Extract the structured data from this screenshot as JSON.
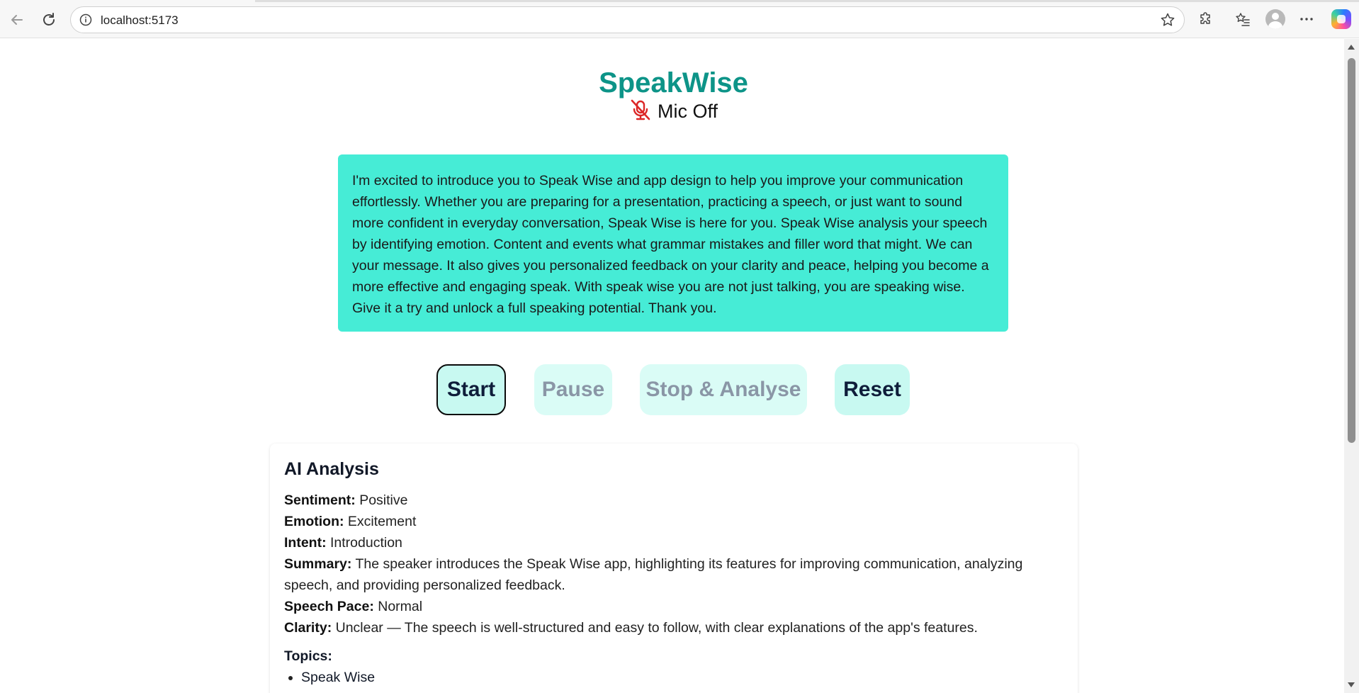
{
  "browser": {
    "url": "localhost:5173"
  },
  "app": {
    "title": "SpeakWise",
    "mic_status": "Mic Off",
    "accent_color": "#0d9488",
    "transcript_bg": "#46ecd6",
    "mic_icon_color": "#dc2626"
  },
  "transcript": {
    "text": "I'm excited to introduce you to Speak Wise and app design to help you improve your communication effortlessly. Whether you are preparing for a presentation, practicing a speech, or just want to sound more confident in everyday conversation, Speak Wise is here for you. Speak Wise analysis your speech by identifying emotion. Content and events what grammar mistakes and filler word that might. We can your message. It also gives you personalized feedback on your clarity and peace, helping you become a more effective and engaging speak. With speak wise you are not just talking, you are speaking wise. Give it a try and unlock a full speaking potential. Thank you."
  },
  "controls": {
    "start": "Start",
    "pause": "Pause",
    "stop": "Stop & Analyse",
    "reset": "Reset"
  },
  "analysis": {
    "heading": "AI Analysis",
    "fields": [
      {
        "label": "Sentiment:",
        "value": "Positive"
      },
      {
        "label": "Emotion:",
        "value": "Excitement"
      },
      {
        "label": "Intent:",
        "value": "Introduction"
      },
      {
        "label": "Summary:",
        "value": "The speaker introduces the Speak Wise app, highlighting its features for improving communication, analyzing speech, and providing personalized feedback."
      },
      {
        "label": "Speech Pace:",
        "value": "Normal"
      },
      {
        "label": "Clarity:",
        "value": "Unclear — The speech is well-structured and easy to follow, with clear explanations of the app's features."
      }
    ],
    "topics_label": "Topics:",
    "topics": [
      "Speak Wise"
    ]
  },
  "icons": {
    "back": "back-arrow-icon",
    "reload": "reload-icon",
    "info": "info-icon",
    "favorite": "star-icon",
    "extensions": "puzzle-icon",
    "favorites": "favorites-list-icon",
    "profile": "avatar",
    "menu": "more-dots-icon",
    "copilot": "copilot-icon",
    "mic": "mic-off-icon"
  }
}
